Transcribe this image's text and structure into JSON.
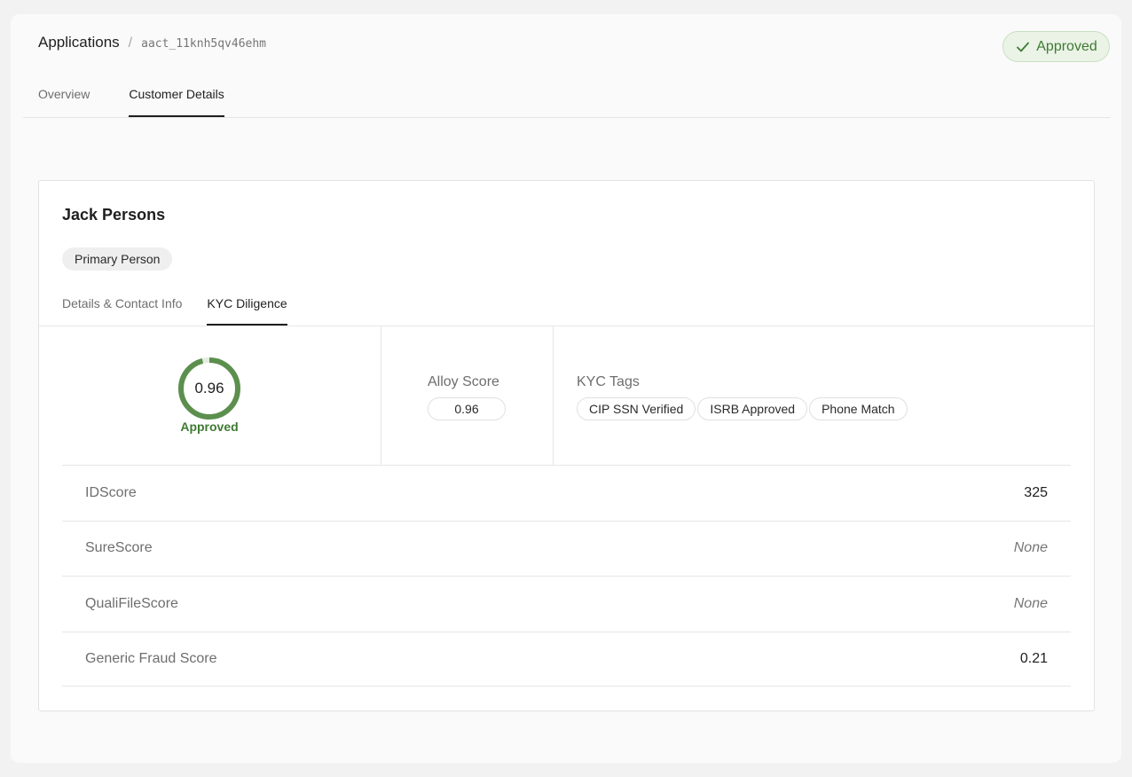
{
  "header": {
    "breadcrumb_root": "Applications",
    "breadcrumb_separator": "/",
    "application_id": "aact_11knh5qv46ehm",
    "status_label": "Approved",
    "status_icon": "check-icon",
    "tabs": [
      {
        "label": "Overview",
        "active": false
      },
      {
        "label": "Customer Details",
        "active": true
      }
    ]
  },
  "person": {
    "name": "Jack Persons",
    "role": "Primary Person",
    "subtabs": [
      {
        "label": "Details & Contact Info",
        "active": false
      },
      {
        "label": "KYC Diligence",
        "active": true
      }
    ]
  },
  "kyc": {
    "gauge_value": "0.96",
    "gauge_fraction": 0.96,
    "gauge_label": "Approved",
    "alloy_score_title": "Alloy Score",
    "alloy_score_value": "0.96",
    "tags_title": "KYC Tags",
    "tags": [
      "CIP SSN Verified",
      "ISRB Approved",
      "Phone Match"
    ],
    "scores": [
      {
        "label": "IDScore",
        "value": "325",
        "is_none": false
      },
      {
        "label": "SureScore",
        "value": "None",
        "is_none": true
      },
      {
        "label": "QualiFileScore",
        "value": "None",
        "is_none": true
      },
      {
        "label": "Generic Fraud Score",
        "value": "0.21",
        "is_none": false
      }
    ]
  },
  "colors": {
    "approved_green": "#3f7a33",
    "gauge_green": "#5c8f4e",
    "pill_background": "#eaf3e6"
  }
}
